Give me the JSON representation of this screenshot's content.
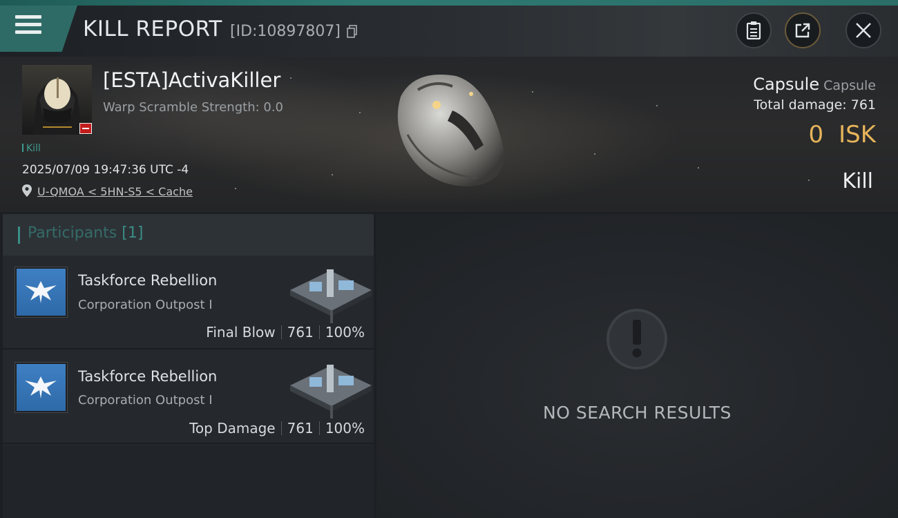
{
  "header": {
    "title": "KILL REPORT",
    "report_id": "[ID:10897807]"
  },
  "victim": {
    "pilot_name": "[ESTA]ActivaKiller",
    "warp_scramble": "Warp Scramble Strength: 0.0",
    "kill_tag": "Kill",
    "datetime": "2025/07/09 19:47:36 UTC -4",
    "location": "U-QMOA < 5HN-S5 < Cache"
  },
  "ship": {
    "name": "Capsule",
    "type": "Capsule",
    "total_damage_label": "Total damage:",
    "total_damage": "761",
    "isk_value": "0",
    "isk_unit": "ISK",
    "result": "Kill"
  },
  "participants": {
    "label": "Participants",
    "count": "[1]",
    "rows": [
      {
        "corp": "Taskforce Rebellion",
        "sub": "Corporation Outpost I",
        "role": "Final Blow",
        "damage": "761",
        "percent": "100%"
      },
      {
        "corp": "Taskforce Rebellion",
        "sub": "Corporation Outpost I",
        "role": "Top Damage",
        "damage": "761",
        "percent": "100%"
      }
    ]
  },
  "results": {
    "empty_text": "NO SEARCH RESULTS"
  },
  "colors": {
    "accent_teal": "#2f6b66",
    "isk_gold": "#e6b55a",
    "alert_red": "#c41d1d"
  },
  "icons": [
    "menu-icon",
    "copy-icon",
    "clipboard-icon",
    "share-icon",
    "close-icon",
    "location-pin-icon",
    "alert-icon"
  ]
}
